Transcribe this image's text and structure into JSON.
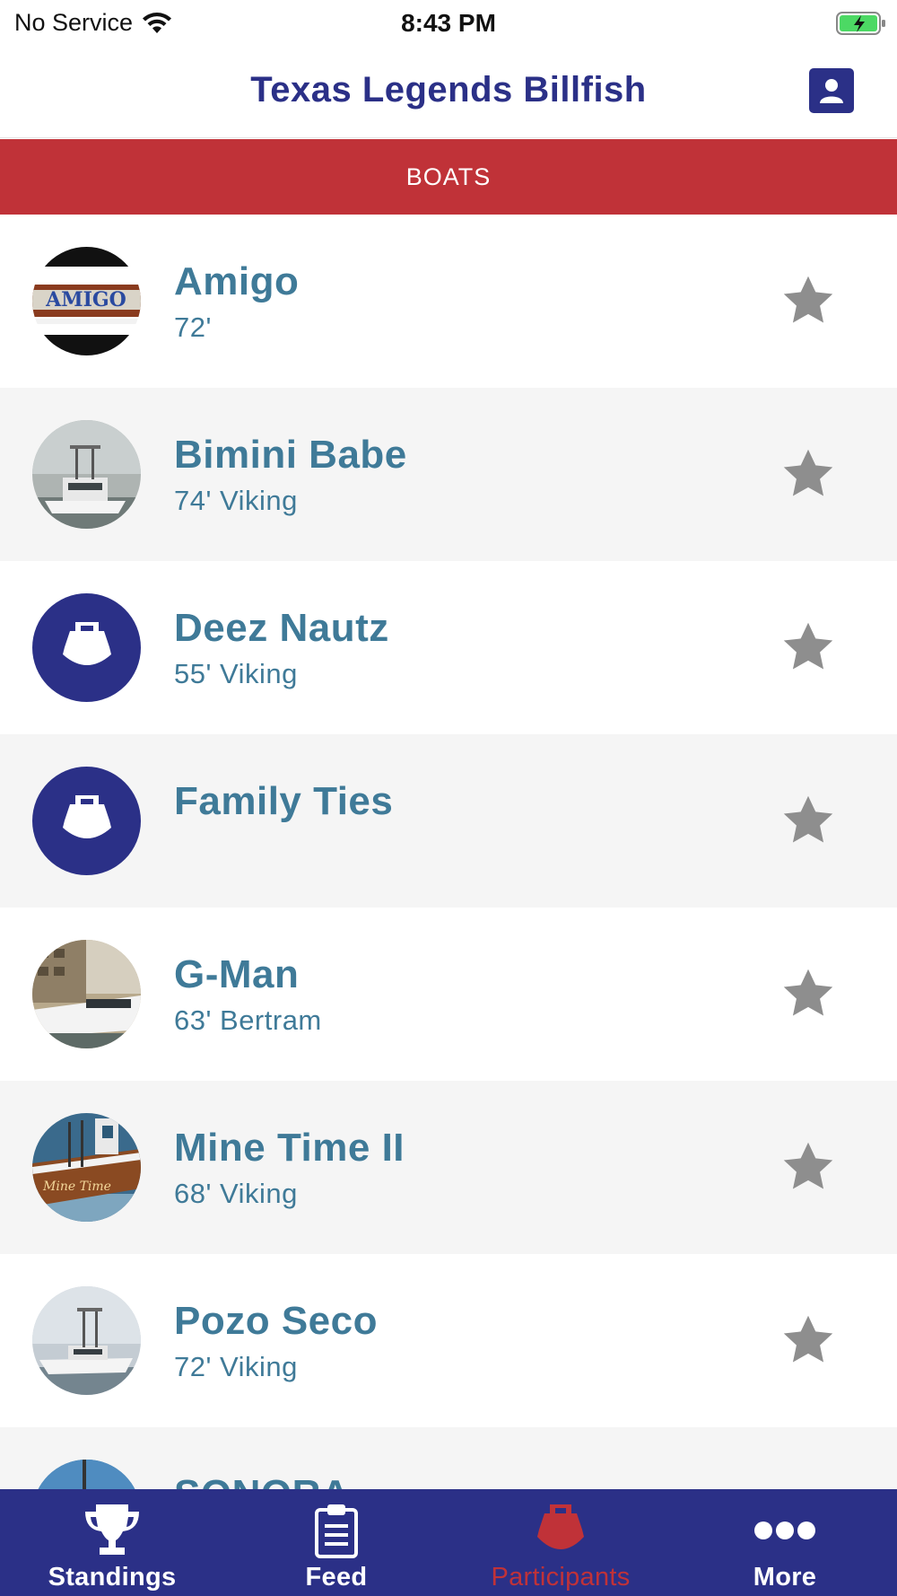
{
  "status_bar": {
    "carrier": "No Service",
    "time": "8:43 PM",
    "battery_color": "#4cd964"
  },
  "header": {
    "title": "Texas Legends Billfish",
    "profile_icon": "person-icon"
  },
  "section": {
    "label": "BOATS"
  },
  "boats": [
    {
      "name": "Amigo",
      "detail": "72'",
      "avatar": "photo"
    },
    {
      "name": "Bimini Babe",
      "detail": "74' Viking",
      "avatar": "photo"
    },
    {
      "name": "Deez Nautz",
      "detail": "55' Viking",
      "avatar": "boat-placeholder-icon"
    },
    {
      "name": "Family Ties",
      "detail": "",
      "avatar": "boat-placeholder-icon"
    },
    {
      "name": "G-Man",
      "detail": "63' Bertram",
      "avatar": "photo"
    },
    {
      "name": "Mine Time II",
      "detail": "68' Viking",
      "avatar": "photo"
    },
    {
      "name": "Pozo Seco",
      "detail": "72' Viking",
      "avatar": "photo"
    },
    {
      "name": "SONORA",
      "detail": "",
      "avatar": "photo"
    }
  ],
  "tabs": [
    {
      "label": "Standings",
      "icon": "trophy-icon",
      "active": false
    },
    {
      "label": "Feed",
      "icon": "clipboard-icon",
      "active": false
    },
    {
      "label": "Participants",
      "icon": "boat-icon",
      "active": true
    },
    {
      "label": "More",
      "icon": "more-dots-icon",
      "active": false
    }
  ],
  "colors": {
    "brand_navy": "#2b3087",
    "section_red": "#c03238",
    "text_teal": "#3f7a98",
    "star_gray": "#8e8e8e"
  }
}
